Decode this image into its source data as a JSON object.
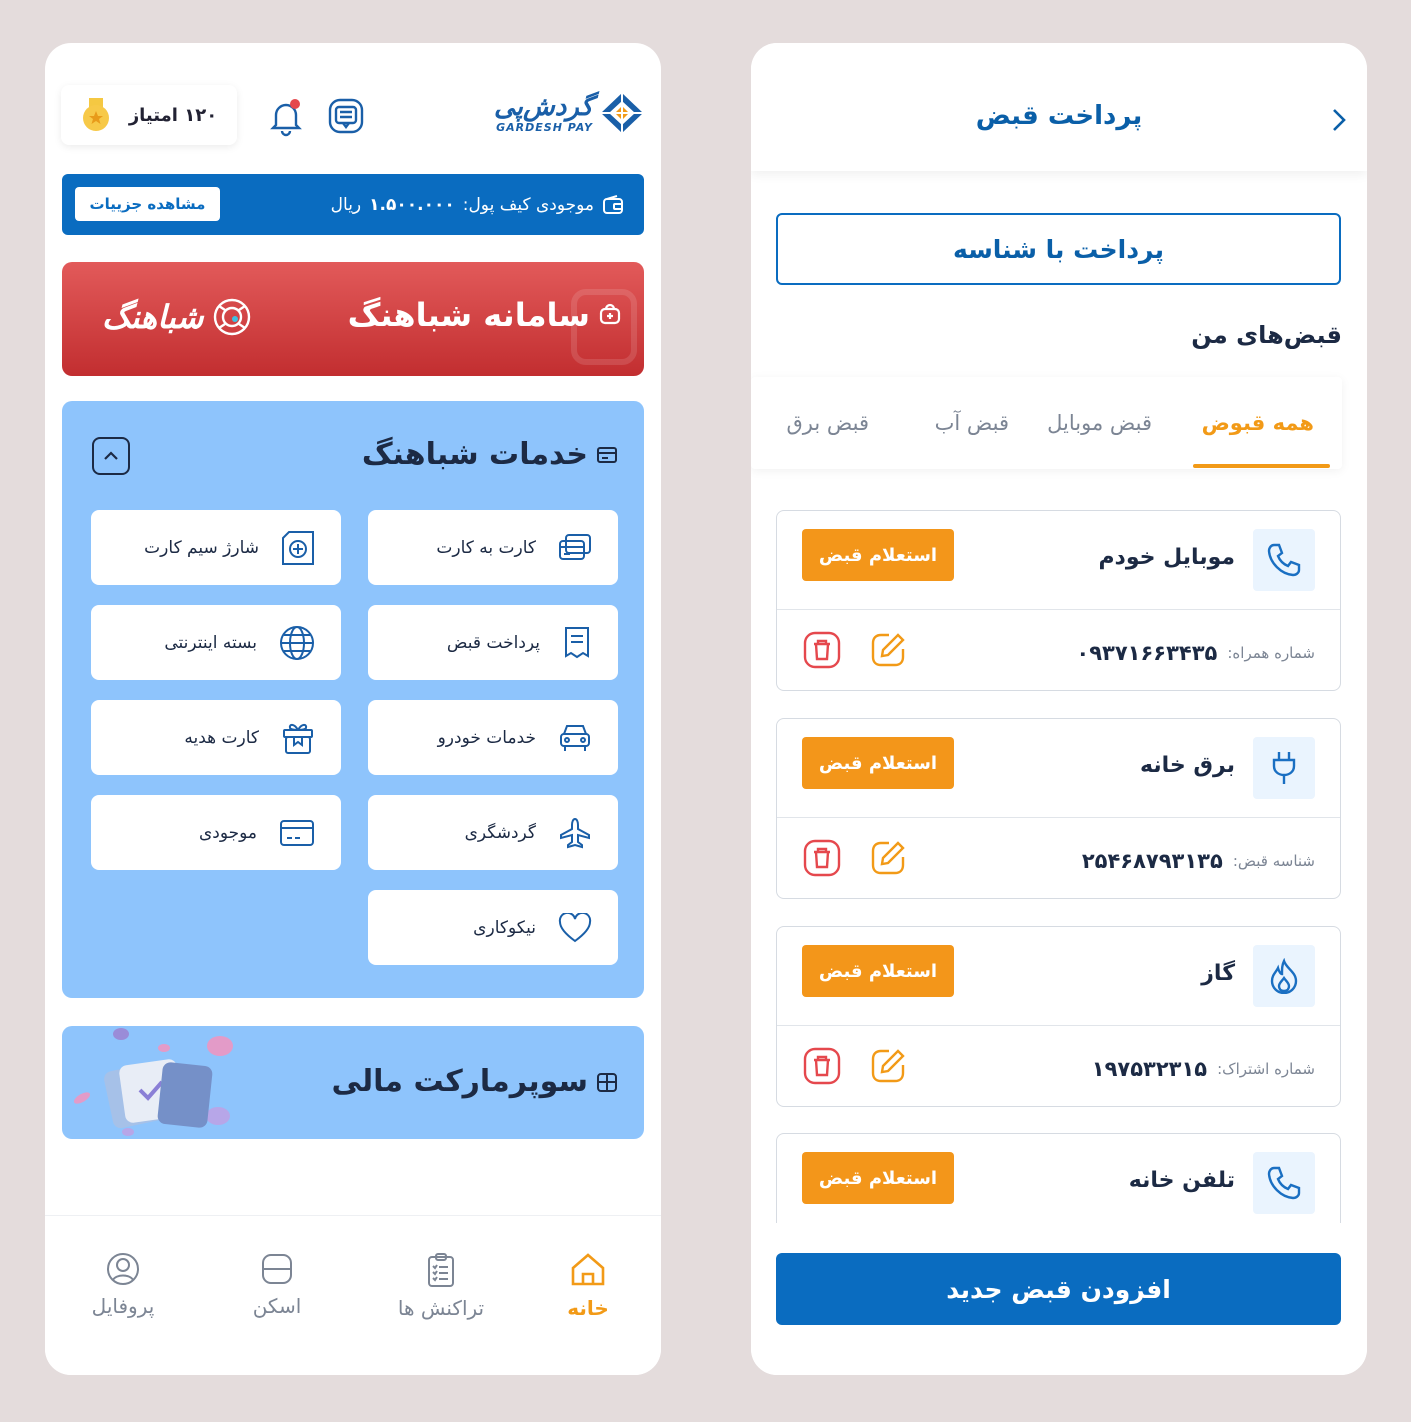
{
  "left": {
    "logo": {
      "fa": "گردش‌پی",
      "en": "GARDESH PAY"
    },
    "points": {
      "label": "۱۲۰ امتیاز"
    },
    "wallet": {
      "label": "موجودی کیف پول:",
      "amount": "۱.۵۰۰.۰۰۰",
      "unit": "ریال",
      "details_button": "مشاهده جزییات"
    },
    "banner": {
      "title": "سامانه شباهنگ",
      "brand": "شباهنگ"
    },
    "services": {
      "title": "خدمات شباهنگ",
      "items": [
        {
          "label": "کارت به کارت",
          "icon": "card-transfer-icon"
        },
        {
          "label": "شارژ سیم کارت",
          "icon": "sim-card-icon"
        },
        {
          "label": "پرداخت قبض",
          "icon": "bill-icon"
        },
        {
          "label": "بسته اینترنتی",
          "icon": "globe-icon"
        },
        {
          "label": "خدمات خودرو",
          "icon": "car-icon"
        },
        {
          "label": "کارت هدیه",
          "icon": "gift-icon"
        },
        {
          "label": "گردشگری",
          "icon": "airplane-icon"
        },
        {
          "label": "موجودی",
          "icon": "wallet-card-icon"
        },
        {
          "label": "نیکوکاری",
          "icon": "heart-icon"
        }
      ]
    },
    "market": {
      "title": "سوپرمارکت مالی"
    },
    "nav": [
      {
        "label": "خانه",
        "icon": "home-icon",
        "active": true
      },
      {
        "label": "تراکنش ها",
        "icon": "clipboard-icon",
        "active": false
      },
      {
        "label": "اسکن",
        "icon": "scan-icon",
        "active": false
      },
      {
        "label": "پروفایل",
        "icon": "profile-icon",
        "active": false
      }
    ]
  },
  "right": {
    "header": {
      "title": "پرداخت قبض"
    },
    "pay_by_id": "پرداخت با شناسه",
    "my_bills_title": "قبض‌های من",
    "tabs": [
      "همه قبوض",
      "قبض موبایل",
      "قبض آب",
      "قبض برق"
    ],
    "bills": [
      {
        "name": "موبایل خودم",
        "icon": "phone-icon",
        "inquiry": "استعلام قبض",
        "key": "شماره همراه:",
        "value": "۰۹۳۷۱۶۶۳۴۳۵"
      },
      {
        "name": "برق خانه",
        "icon": "plug-icon",
        "inquiry": "استعلام قبض",
        "key": "شناسه قبض:",
        "value": "۲۵۴۶۸۷۹۳۱۳۵"
      },
      {
        "name": "گاز",
        "icon": "flame-icon",
        "inquiry": "استعلام قبض",
        "key": "شماره اشتراک:",
        "value": "۱۹۷۵۳۲۳۱۵"
      },
      {
        "name": "تلفن خانه",
        "icon": "phone-icon",
        "inquiry": "استعلام قبض",
        "key": "",
        "value": ""
      }
    ],
    "add_button": "افزودن قبض جدید"
  },
  "colors": {
    "primary": "#0a6cc0",
    "accent": "#f29a17",
    "danger": "#e5484d",
    "services_bg": "#8ec4fc",
    "banner_red": "#c22e30"
  }
}
